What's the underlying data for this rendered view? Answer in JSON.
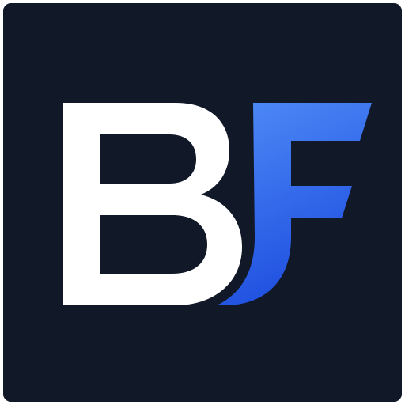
{
  "logo": {
    "letters": "BF",
    "first_letter": "B",
    "second_letter": "F",
    "colors": {
      "page_border": "#ffffff",
      "background": "#111827",
      "first_letter": "#ffffff",
      "second_letter_light": "#4f8cf7",
      "second_letter_dark": "#1f4fe0"
    }
  }
}
